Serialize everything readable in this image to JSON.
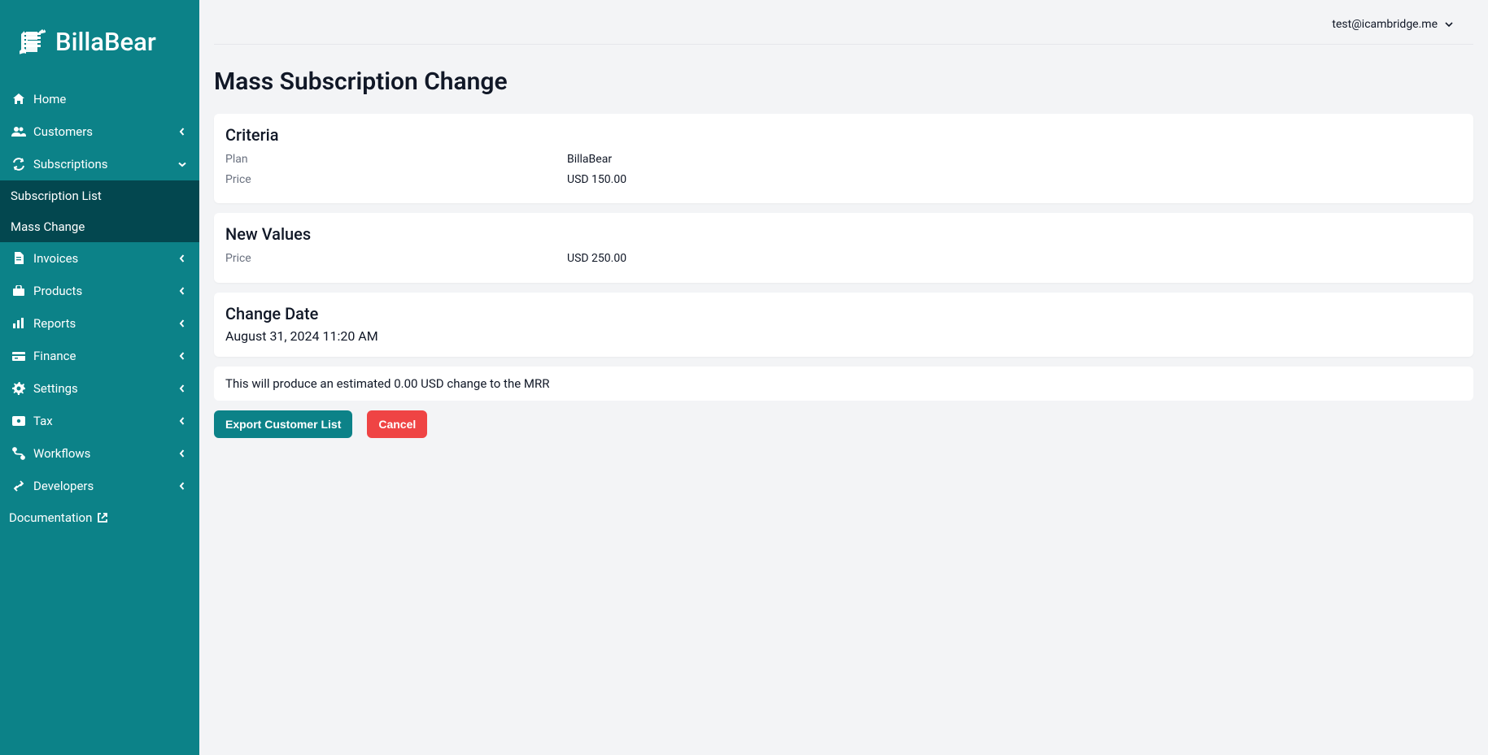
{
  "brand": "BillaBear",
  "user_email": "test@icambridge.me",
  "sidebar": {
    "items": [
      {
        "label": "Home",
        "icon": "home",
        "expandable": false
      },
      {
        "label": "Customers",
        "icon": "customers",
        "expandable": true,
        "open": false
      },
      {
        "label": "Subscriptions",
        "icon": "subscriptions",
        "expandable": true,
        "open": true,
        "children": [
          {
            "label": "Subscription List"
          },
          {
            "label": "Mass Change"
          }
        ]
      },
      {
        "label": "Invoices",
        "icon": "invoices",
        "expandable": true,
        "open": false
      },
      {
        "label": "Products",
        "icon": "products",
        "expandable": true,
        "open": false
      },
      {
        "label": "Reports",
        "icon": "reports",
        "expandable": true,
        "open": false
      },
      {
        "label": "Finance",
        "icon": "finance",
        "expandable": true,
        "open": false
      },
      {
        "label": "Settings",
        "icon": "settings",
        "expandable": true,
        "open": false
      },
      {
        "label": "Tax",
        "icon": "tax",
        "expandable": true,
        "open": false
      },
      {
        "label": "Workflows",
        "icon": "workflows",
        "expandable": true,
        "open": false
      },
      {
        "label": "Developers",
        "icon": "developers",
        "expandable": true,
        "open": false
      }
    ],
    "documentation": "Documentation"
  },
  "page": {
    "title": "Mass Subscription Change",
    "criteria": {
      "heading": "Criteria",
      "plan_label": "Plan",
      "plan_value": "BillaBear",
      "price_label": "Price",
      "price_value": "USD 150.00"
    },
    "new_values": {
      "heading": "New Values",
      "price_label": "Price",
      "price_value": "USD 250.00"
    },
    "change_date": {
      "heading": "Change Date",
      "value": "August 31, 2024 11:20 AM"
    },
    "mrr_impact": "This will produce an estimated 0.00 USD change to the MRR",
    "buttons": {
      "export": "Export Customer List",
      "cancel": "Cancel"
    }
  }
}
